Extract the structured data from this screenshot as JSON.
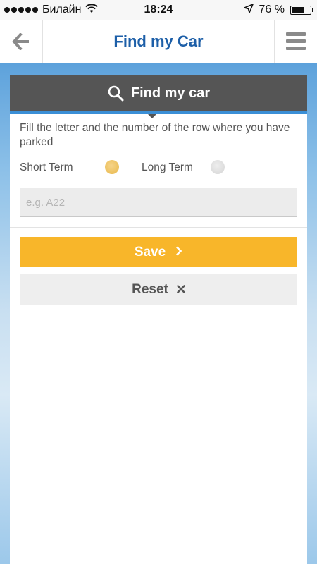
{
  "status_bar": {
    "carrier": "Билайн",
    "time": "18:24",
    "battery": "76 %",
    "battery_level": 0.76
  },
  "nav": {
    "title": "Find my Car"
  },
  "panel": {
    "header_title": "Find my car",
    "instructions": "Fill the letter and the number of the row where you have parked",
    "options": {
      "short_term": "Short Term",
      "long_term": "Long Term",
      "selected": "short_term"
    },
    "input": {
      "placeholder": "e.g. A22",
      "value": ""
    },
    "save_label": "Save",
    "reset_label": "Reset"
  },
  "icons": {
    "back": "arrow-left-icon",
    "menu": "hamburger-icon",
    "search": "search-icon",
    "save_chevron": "chevron-right-icon",
    "reset_x": "close-icon"
  },
  "colors": {
    "title_blue": "#1d5fa8",
    "save_yellow": "#f8b62a",
    "header_gray": "#555555",
    "accent_blue": "#3b8fd6"
  }
}
